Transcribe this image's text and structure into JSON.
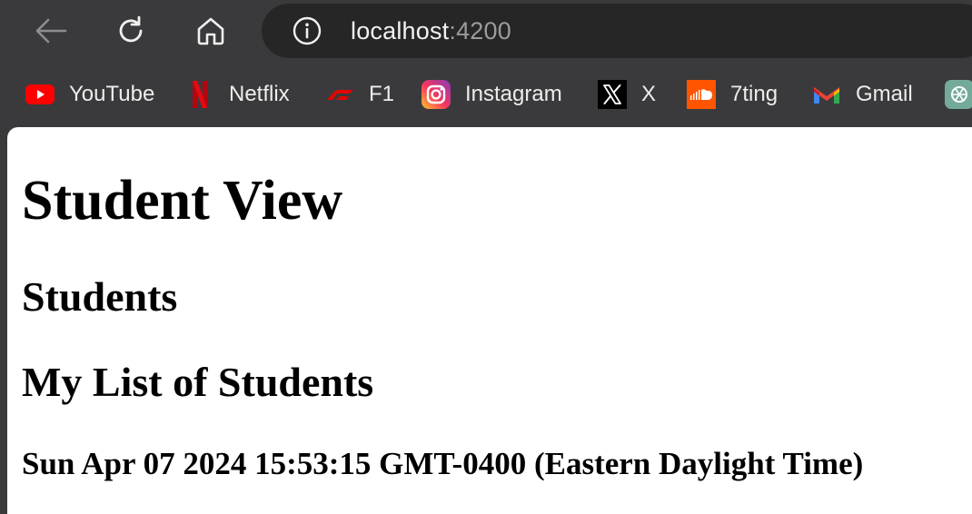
{
  "browser": {
    "nav": {
      "back_icon": "back-arrow-icon",
      "reload_icon": "reload-icon",
      "home_icon": "home-icon"
    },
    "address_bar": {
      "host": "localhost",
      "port": ":4200",
      "info_icon": "info-icon"
    },
    "bookmarks": [
      {
        "label": "YouTube",
        "icon": "youtube-icon"
      },
      {
        "label": "Netflix",
        "icon": "netflix-icon"
      },
      {
        "label": "F1",
        "icon": "f1-icon"
      },
      {
        "label": "Instagram",
        "icon": "instagram-icon"
      },
      {
        "label": "X",
        "icon": "x-icon"
      },
      {
        "label": "7ting",
        "icon": "soundcloud-icon"
      },
      {
        "label": "Gmail",
        "icon": "gmail-icon"
      },
      {
        "label": "",
        "icon": "chatgpt-icon"
      }
    ]
  },
  "page": {
    "title": "Student View",
    "section_heading": "Students",
    "list_heading": "My List of Students",
    "date_text": "Sun Apr 07 2024 15:53:15 GMT-0400 (Eastern Daylight Time)"
  },
  "colors": {
    "chrome_bg": "#3a3a3c",
    "omnibox_bg": "#262627",
    "youtube": "#ff0000",
    "netflix": "#e50914",
    "f1": "#e10600",
    "soundcloud": "#ff5500",
    "gmail_red": "#ea4335",
    "chatgpt": "#74aa9c"
  }
}
